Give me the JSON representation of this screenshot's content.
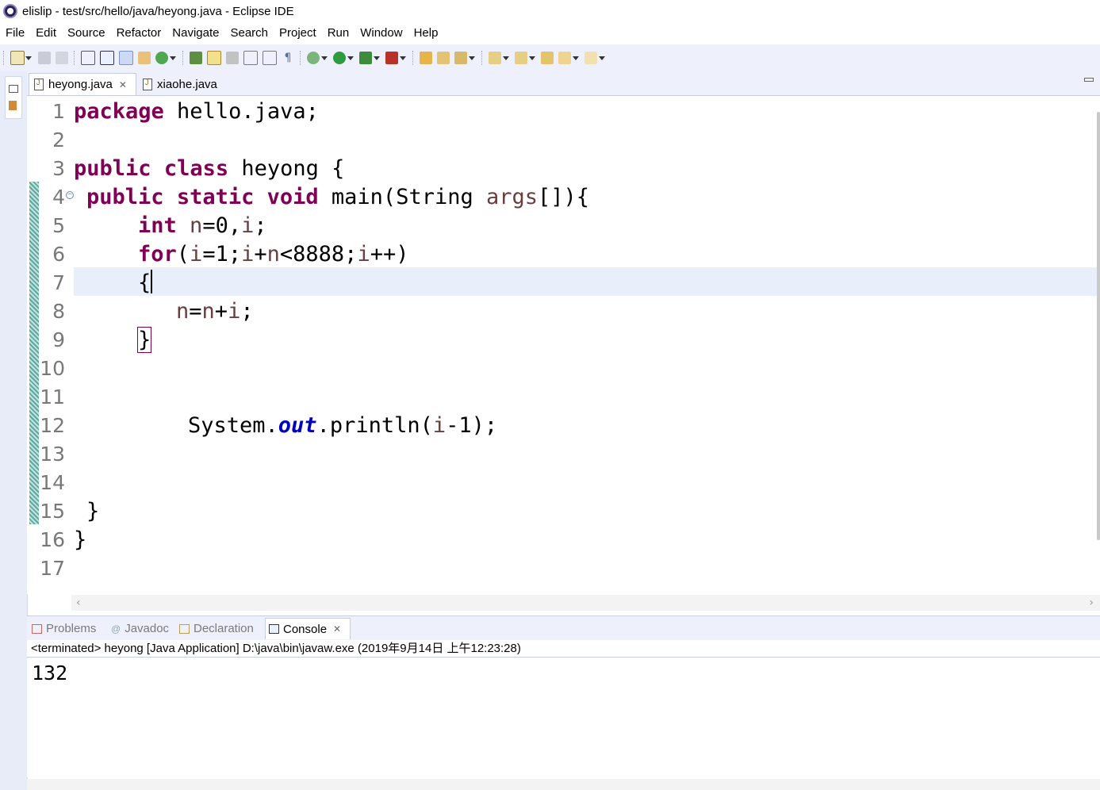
{
  "window": {
    "title": "elislip - test/src/hello/java/heyong.java - Eclipse IDE"
  },
  "menu": [
    "File",
    "Edit",
    "Source",
    "Refactor",
    "Navigate",
    "Search",
    "Project",
    "Run",
    "Window",
    "Help"
  ],
  "editor_tabs": [
    {
      "label": "heyong.java",
      "active": true
    },
    {
      "label": "xiaohe.java",
      "active": false
    }
  ],
  "code_lines": [
    {
      "num": "1"
    },
    {
      "num": "2"
    },
    {
      "num": "3"
    },
    {
      "num": "4"
    },
    {
      "num": "5"
    },
    {
      "num": "6"
    },
    {
      "num": "7"
    },
    {
      "num": "8"
    },
    {
      "num": "9"
    },
    {
      "num": "10"
    },
    {
      "num": "11"
    },
    {
      "num": "12"
    },
    {
      "num": "13"
    },
    {
      "num": "14"
    },
    {
      "num": "15"
    },
    {
      "num": "16"
    },
    {
      "num": "17"
    }
  ],
  "code": {
    "l1_kw": "package",
    "l1_rest": " hello.java;",
    "l3_kw1": "public",
    "l3_kw2": "class",
    "l3_rest": " heyong {",
    "l4_kw1": "public",
    "l4_kw2": "static",
    "l4_kw3": "void",
    "l4_a": " main(String ",
    "l4_var": "args",
    "l4_b": "[]){",
    "l5_kw": "int",
    "l5_a": "n",
    "l5_b": "=0,",
    "l5_c": "i",
    "l5_d": ";",
    "l6_kw": "for",
    "l6_a": "(",
    "l6_b": "i",
    "l6_c": "=1;",
    "l6_d": "i",
    "l6_e": "+",
    "l6_f": "n",
    "l6_g": "<8888;",
    "l6_h": "i",
    "l6_i": "++)",
    "l7": "{",
    "l8_a": "n",
    "l8_b": "=",
    "l8_c": "n",
    "l8_d": "+",
    "l8_e": "i",
    "l8_f": ";",
    "l9": "}",
    "l12_a": "System.",
    "l12_fld": "out",
    "l12_b": ".println(",
    "l12_c": "i",
    "l12_d": "-1);",
    "l15": "}",
    "l16": "}"
  },
  "bottom_tabs": [
    {
      "label": "Problems",
      "active": false
    },
    {
      "label": "Javadoc",
      "active": false
    },
    {
      "label": "Declaration",
      "active": false
    },
    {
      "label": "Console",
      "active": true
    }
  ],
  "console": {
    "status": "<terminated> heyong [Java Application] D:\\java\\bin\\javaw.exe (2019年9月14日 上午12:23:28)",
    "output": "132"
  }
}
